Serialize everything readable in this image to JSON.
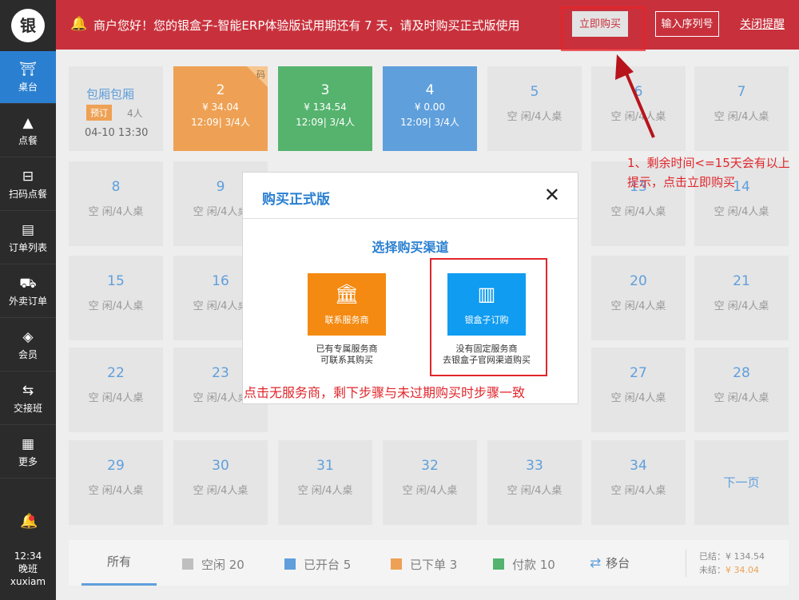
{
  "sidebar": {
    "logo": "银",
    "items": [
      {
        "icon": "table-icon",
        "glyph": "⛩",
        "label": "桌台"
      },
      {
        "icon": "dish-icon",
        "glyph": "▲",
        "label": "点餐"
      },
      {
        "icon": "scan-icon",
        "glyph": "⊟",
        "label": "扫码点餐"
      },
      {
        "icon": "order-list-icon",
        "glyph": "▤",
        "label": "订单列表"
      },
      {
        "icon": "delivery-icon",
        "glyph": "⛟",
        "label": "外卖订单"
      },
      {
        "icon": "member-icon",
        "glyph": "◈",
        "label": "会员"
      },
      {
        "icon": "shift-icon",
        "glyph": "⇆",
        "label": "交接班"
      },
      {
        "icon": "more-icon",
        "glyph": "▦",
        "label": "更多"
      }
    ],
    "time": "12:34",
    "shift": "晚班",
    "user": "xuxiam"
  },
  "banner": {
    "message": "商户您好！您的银盒子-智能ERP体验版试用期还有 7 天，请及时购买正式版使用",
    "buy_now": "立即购买",
    "enter_serial": "输入序列号",
    "close_tip": "关闭提醒",
    "bg_color": "#c8313c"
  },
  "room": {
    "name": "包厢包厢",
    "badge": "预订",
    "people": "4人",
    "time": "04-10 13:30"
  },
  "occupied_tables": [
    {
      "num": "2",
      "amount": "¥ 34.04",
      "time": "12:09| 3/4人",
      "status": "orange",
      "corner": "码"
    },
    {
      "num": "3",
      "amount": "¥ 134.54",
      "time": "12:09| 3/4人",
      "status": "green",
      "corner": ""
    },
    {
      "num": "4",
      "amount": "¥ 0.00",
      "time": "12:09| 3/4人",
      "status": "blue",
      "corner": ""
    }
  ],
  "empty_status": "空 闲/4人桌",
  "tables": [
    "5",
    "6",
    "7",
    "8",
    "9",
    "13",
    "14",
    "15",
    "16",
    "20",
    "21",
    "22",
    "23",
    "27",
    "28",
    "29",
    "30",
    "31",
    "32",
    "33",
    "34"
  ],
  "next_page": "下一页",
  "bottom": {
    "tab_all": "所有",
    "legend": [
      {
        "label": "空闲 20",
        "color": "#aaaaaa"
      },
      {
        "label": "已开台 5",
        "color": "#2a7fd0"
      },
      {
        "label": "已下单 3",
        "color": "#e8821b"
      },
      {
        "label": "付款 10",
        "color": "#1c9a3d"
      }
    ],
    "move_table": "移台",
    "settled": "已结：¥ 134.54",
    "unsettled_label": "未结：",
    "unsettled_value": "¥ 34.04"
  },
  "modal": {
    "title": "购买正式版",
    "subtitle": "选择购买渠道",
    "option1": {
      "label": "联系服务商",
      "desc1": "已有专属服务商",
      "desc2": "可联系其购买",
      "color": "#f48a11"
    },
    "option2": {
      "label": "银盒子订购",
      "desc1": "没有固定服务商",
      "desc2": "去银盒子官网渠道购买",
      "color": "#109cf0"
    }
  },
  "annotations": {
    "note_bottom": "点击无服务商，剩下步骤与未过期购买时步骤一致",
    "note_right": "1、剩余时间<=15天会有以上提示，点击立即购买"
  }
}
